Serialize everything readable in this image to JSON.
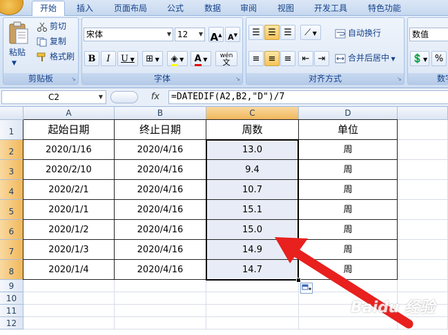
{
  "ribbon": {
    "tabs": [
      "开始",
      "插入",
      "页面布局",
      "公式",
      "数据",
      "审阅",
      "视图",
      "开发工具",
      "特色功能"
    ],
    "active_tab": "开始",
    "clipboard": {
      "paste": "粘贴",
      "cut": "剪切",
      "copy": "复制",
      "format_painter": "格式刷",
      "label": "剪贴板"
    },
    "font": {
      "font_name": "宋体",
      "font_size": "12",
      "bold": "B",
      "italic": "I",
      "underline": "U",
      "grow": "A",
      "shrink": "A",
      "font_color": "A",
      "phonetic": "wén",
      "phonetic_char": "文",
      "label": "字体"
    },
    "alignment": {
      "wrap_text": "自动换行",
      "merge_center": "合并后居中",
      "label": "对齐方式"
    },
    "number": {
      "format": "数值",
      "label": "数字",
      "percent": "%"
    }
  },
  "formula_bar": {
    "name_box": "C2",
    "fx": "fx",
    "formula": "=DATEDIF(A2,B2,\"D\")/7"
  },
  "sheet": {
    "columns": [
      "A",
      "B",
      "C",
      "D"
    ],
    "rows": [
      "1",
      "2",
      "3",
      "4",
      "5",
      "6",
      "7",
      "8",
      "9",
      "10",
      "11",
      "12"
    ],
    "header": [
      "起始日期",
      "终止日期",
      "周数",
      "单位"
    ],
    "data": [
      [
        "2020/1/16",
        "2020/4/16",
        "13.0",
        "周"
      ],
      [
        "2020/2/10",
        "2020/4/16",
        "9.4",
        "周"
      ],
      [
        "2020/2/1",
        "2020/4/16",
        "10.7",
        "周"
      ],
      [
        "2020/1/1",
        "2020/4/16",
        "15.1",
        "周"
      ],
      [
        "2020/1/2",
        "2020/4/16",
        "15.0",
        "周"
      ],
      [
        "2020/1/3",
        "2020/4/16",
        "14.9",
        "周"
      ],
      [
        "2020/1/4",
        "2020/4/16",
        "14.7",
        "周"
      ]
    ]
  },
  "watermark": "Baidu 经验",
  "colors": {
    "accent": "#15428b",
    "arrow": "#e8201e",
    "selection": "#e8ecf6"
  }
}
